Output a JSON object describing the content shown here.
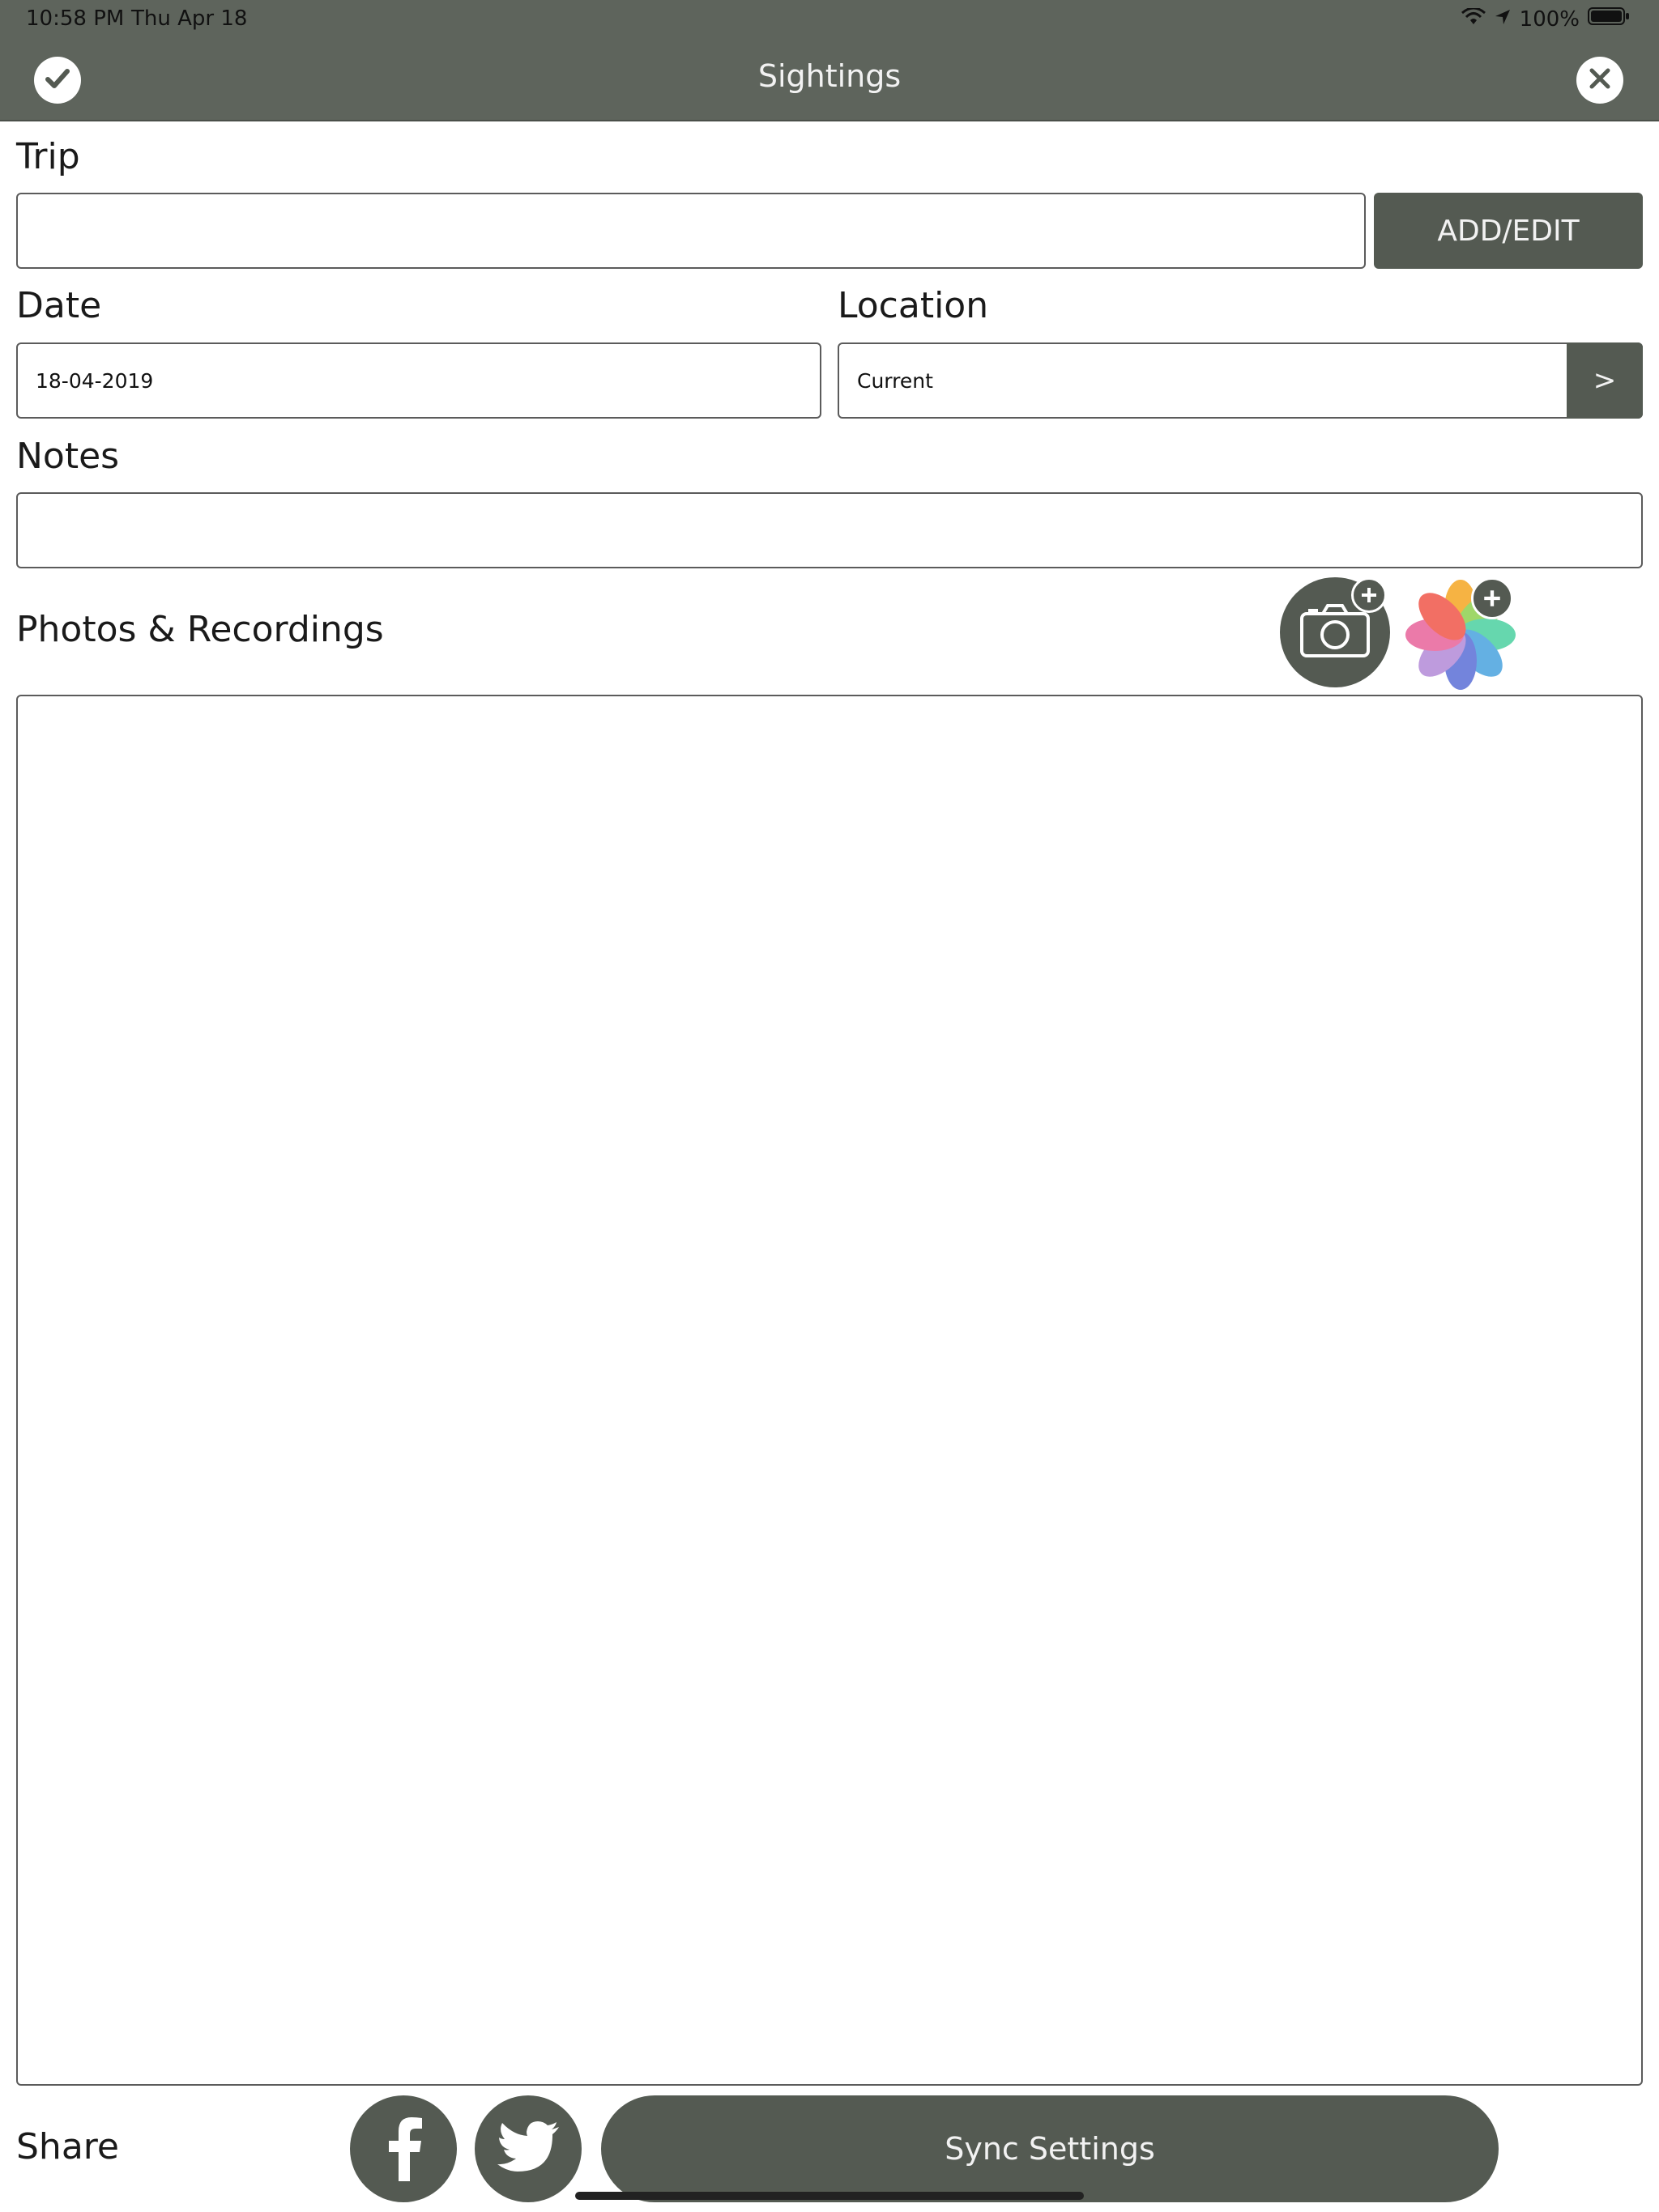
{
  "status_bar": {
    "time": "10:58 PM",
    "date": "Thu Apr 18",
    "battery": "100%",
    "icons": [
      "wifi-icon",
      "location-arrow-icon",
      "battery-icon"
    ]
  },
  "nav": {
    "title": "Sightings",
    "confirm_icon": "checkmark-icon",
    "close_icon": "close-icon"
  },
  "form": {
    "trip": {
      "label": "Trip",
      "value": "",
      "button_label": "ADD/EDIT"
    },
    "date": {
      "label": "Date",
      "value": "18-04-2019"
    },
    "location": {
      "label": "Location",
      "value": "Current",
      "button_label": ">"
    },
    "notes": {
      "label": "Notes",
      "value": ""
    }
  },
  "media": {
    "label": "Photos & Recordings",
    "camera_icon": "camera-add-icon",
    "gallery_icon": "photos-add-icon"
  },
  "share": {
    "label": "Share",
    "facebook_icon": "facebook-icon",
    "twitter_icon": "twitter-icon",
    "sync_label": "Sync Settings"
  },
  "colors": {
    "bar": "#5e645c",
    "button": "#545a52",
    "border": "#5b5b5b"
  }
}
